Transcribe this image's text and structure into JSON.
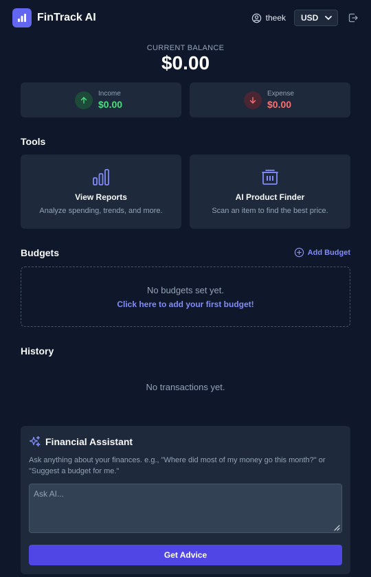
{
  "header": {
    "app_title": "FinTrack AI",
    "logo_icon": "bar-chart-icon",
    "user_icon": "user-circle-icon",
    "user_name": "theek",
    "currency": "USD",
    "logout_icon": "logout-icon"
  },
  "balance": {
    "label": "CURRENT BALANCE",
    "value": "$0.00"
  },
  "income": {
    "label": "Income",
    "value": "$0.00",
    "icon": "arrow-up-icon",
    "color": "#4ade80"
  },
  "expense": {
    "label": "Expense",
    "value": "$0.00",
    "icon": "arrow-down-icon",
    "color": "#f87171"
  },
  "tools": {
    "title": "Tools",
    "items": [
      {
        "title": "View Reports",
        "desc": "Analyze spending, trends, and more.",
        "icon": "bar-chart-icon"
      },
      {
        "title": "AI Product Finder",
        "desc": "Scan an item to find the best price.",
        "icon": "barcode-scanner-icon"
      }
    ]
  },
  "budgets": {
    "title": "Budgets",
    "add_label": "Add Budget",
    "empty_text": "No budgets set yet.",
    "empty_link": "Click here to add your first budget!"
  },
  "history": {
    "title": "History",
    "empty_text": "No transactions yet."
  },
  "assistant": {
    "title": "Financial Assistant",
    "icon": "sparkles-icon",
    "desc": "Ask anything about your finances. e.g., \"Where did most of my money go this month?\" or \"Suggest a budget for me.\"",
    "placeholder": "Ask AI...",
    "value": "",
    "button_label": "Get Advice"
  },
  "colors": {
    "background": "#0f172a",
    "card": "#1e293b",
    "accent": "#6366f1",
    "button": "#4f46e5",
    "link": "#818cf8"
  }
}
